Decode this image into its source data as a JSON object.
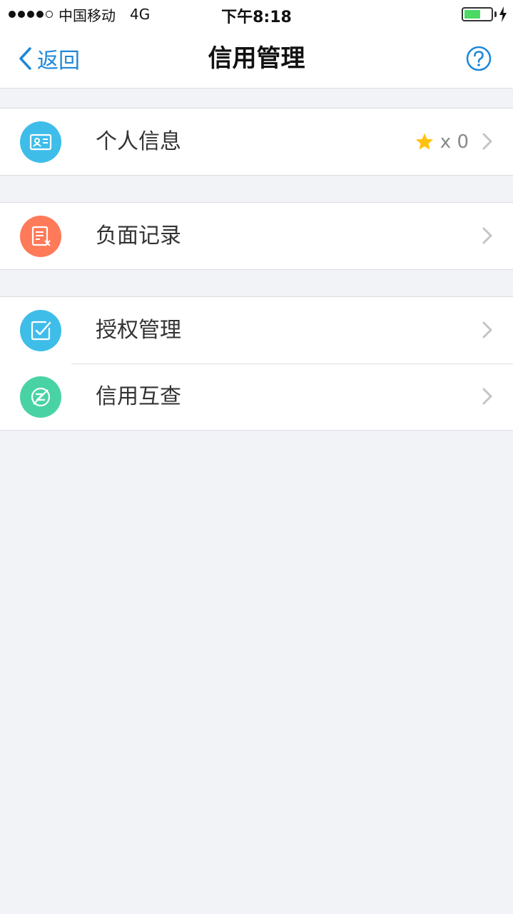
{
  "status_bar": {
    "carrier": "中国移动",
    "network": "4G",
    "time": "下午8:18"
  },
  "nav": {
    "back_label": "返回",
    "title": "信用管理",
    "help_icon": "question-circle-icon"
  },
  "groups": [
    {
      "items": [
        {
          "label": "个人信息",
          "icon": "id-card-icon",
          "color": "#3fbde9",
          "badge_count": "x 0",
          "badge_icon": "star-icon"
        }
      ]
    },
    {
      "items": [
        {
          "label": "负面记录",
          "icon": "record-x-icon",
          "color": "#ff7a59"
        }
      ]
    },
    {
      "items": [
        {
          "label": "授权管理",
          "icon": "check-edit-icon",
          "color": "#3fbde9"
        },
        {
          "label": "信用互查",
          "icon": "mutual-check-icon",
          "color": "#49d3a4"
        }
      ]
    }
  ],
  "colors": {
    "accent": "#1e88d8",
    "star": "#ffc20e",
    "battery": "#4cd964"
  }
}
